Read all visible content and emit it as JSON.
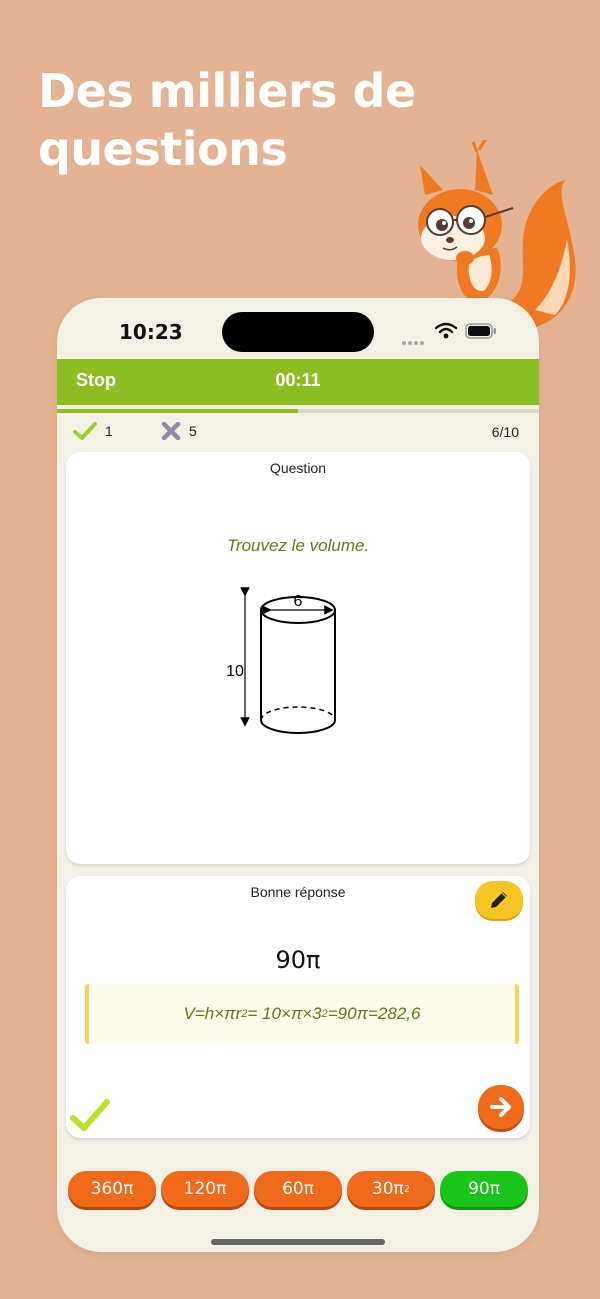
{
  "headline": [
    "Des milliers de",
    "questions"
  ],
  "status": {
    "time": "10:23"
  },
  "topbar": {
    "stop_label": "Stop",
    "timer": "00:11"
  },
  "progress": {
    "fraction": 0.5
  },
  "stats": {
    "correct_count": "1",
    "wrong_count": "5",
    "counter": "6/10"
  },
  "question": {
    "title": "Question",
    "prompt": "Trouvez le volume.",
    "figure": {
      "diameter_label": "6",
      "height_label": "10"
    }
  },
  "answer": {
    "title": "Bonne réponse",
    "value": "90π",
    "formula": {
      "p1": "V=h×πr",
      "e1": "2",
      "p2": " = 10×π×3",
      "e2": "2",
      "p3": "=90π=282,6"
    }
  },
  "choices": [
    {
      "base": "360π",
      "sup": "",
      "correct": false
    },
    {
      "base": "120π",
      "sup": "",
      "correct": false
    },
    {
      "base": "60π",
      "sup": "",
      "correct": false
    },
    {
      "base": "30π",
      "sup": "2",
      "correct": false
    },
    {
      "base": "90π",
      "sup": "",
      "correct": true
    }
  ],
  "colors": {
    "accent_green": "#8dbd22",
    "answer_orange": "#ef6a1b",
    "correct_green": "#19c51b",
    "background": "#e3b393"
  },
  "icons": [
    "check-icon",
    "cross-icon",
    "pencil-icon",
    "arrow-right-icon",
    "wifi-icon",
    "battery-icon",
    "squirrel-mascot"
  ]
}
